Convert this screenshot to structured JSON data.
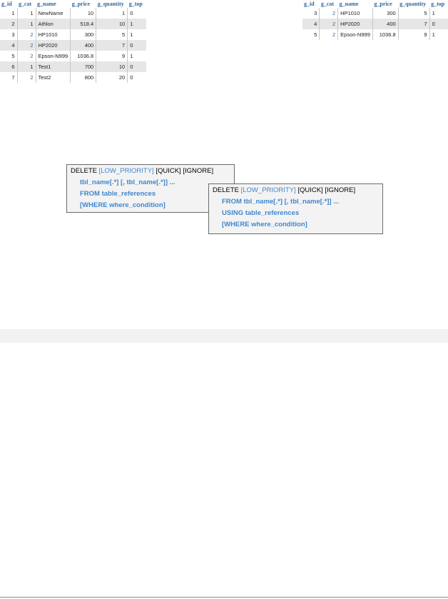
{
  "left_table": {
    "columns": [
      "g_id",
      "g_cat",
      "g_name",
      "g_price",
      "g_quantity",
      "g_top"
    ],
    "rows": [
      [
        "1",
        "1",
        "NewName",
        "10",
        "1",
        "0"
      ],
      [
        "2",
        "1",
        "Athlon",
        "518.4",
        "10",
        "1"
      ],
      [
        "3",
        "2",
        "HP1010",
        "300",
        "5",
        "1"
      ],
      [
        "4",
        "2",
        "HP2020",
        "400",
        "7",
        "0"
      ],
      [
        "5",
        "2",
        "Epson-N999",
        "1036.8",
        "9",
        "1"
      ],
      [
        "6",
        "1",
        "Test1",
        "700",
        "10",
        "0"
      ],
      [
        "7",
        "2",
        "Test2",
        "800",
        "20",
        "0"
      ]
    ]
  },
  "right_table": {
    "columns": [
      "g_id",
      "g_cat",
      "g_name",
      "g_price",
      "g_quantity",
      "g_top"
    ],
    "rows": [
      [
        "3",
        "2",
        "HP1010",
        "300",
        "5",
        "1"
      ],
      [
        "4",
        "2",
        "HP2020",
        "400",
        "7",
        "0"
      ],
      [
        "5",
        "2",
        "Epson-N999",
        "1036.8",
        "9",
        "1"
      ]
    ]
  },
  "syntax_single": {
    "keyword": "DELETE",
    "low_priority": "[LOW_PRIORITY]",
    "quick_ignore": "[QUICK] [IGNORE]",
    "line1": "tbl_name[.*] [, tbl_name[.*]] ...",
    "line2": "FROM table_references",
    "line3": "[WHERE where_condition]"
  },
  "syntax_multi": {
    "keyword": "DELETE",
    "low_priority": "[LOW_PRIORITY]",
    "quick_ignore": "[QUICK] [IGNORE]",
    "line1": "FROM tbl_name[.*] [, tbl_name[.*]] ...",
    "line2": "USING table_references",
    "line3": "[WHERE where_condition]"
  },
  "colors": {
    "header_text": "#336699",
    "syntax_option": "#3f87cf",
    "row_alt": "#e6e6e6",
    "box_bg": "#f3f3f3"
  }
}
